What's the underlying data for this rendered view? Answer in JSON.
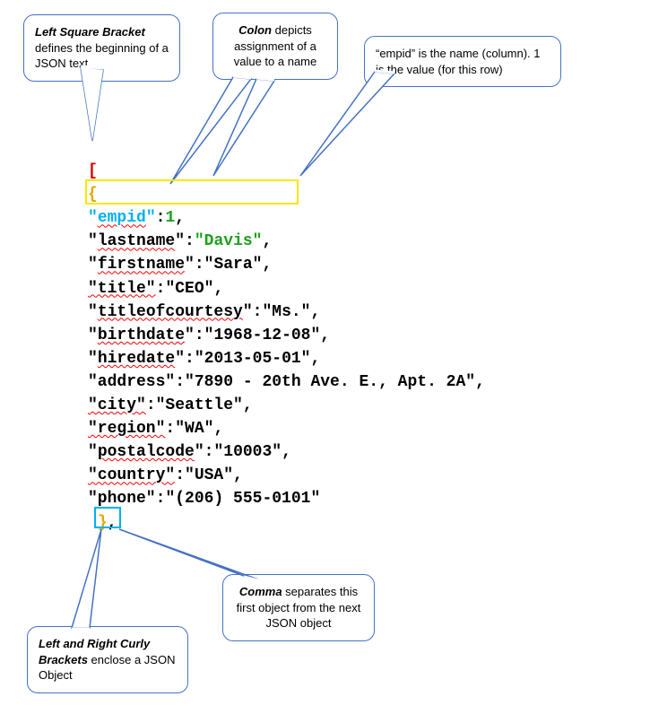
{
  "callouts": {
    "left_bracket": "Left Square Bracket",
    "left_bracket_rest": " defines the beginning of a JSON text",
    "colon": "Colon",
    "colon_rest": " depicts assignment of a value to a name",
    "empid": "“empid” is the name (column). 1 is the value (for this row)",
    "curly": "Left and Right Curly Brackets",
    "curly_rest": " enclose a JSON Object",
    "comma": "Comma",
    "comma_rest": " separates this first object from the next JSON object"
  },
  "json_tokens": {
    "open_bracket": "[",
    "open_brace": "{",
    "k00": "\"",
    "k00b": "empid",
    "k00c": "\"",
    "colon0": ":",
    "v00": "1",
    "comma0": ",",
    "k01": "\"",
    "k01b": "lastname",
    "k01c": "\"",
    "colon1": ":",
    "v01": "\"Davis\"",
    "comma1": ",",
    "k02": "\"",
    "k02b": "firstname",
    "k02c": "\"",
    "colon2": ":",
    "v02": "\"Sara\"",
    "comma2": ",",
    "k03": "\"title\"",
    "colon3": ":",
    "v03": "\"CEO\"",
    "comma3": ",",
    "k04": "\"",
    "k04b": "titleofcourtesy",
    "k04c": "\"",
    "colon4": ":",
    "v04": "\"Ms.\"",
    "comma4": ",",
    "k05": "\"",
    "k05b": "birthdate",
    "k05c": "\"",
    "colon5": ":",
    "v05": "\"1968-12-08\"",
    "comma5": ",",
    "k06": "\"",
    "k06b": "hiredate",
    "k06c": "\"",
    "colon6": ":",
    "v06": "\"2013-05-01\"",
    "comma6": ",",
    "k07": "\"address\"",
    "colon7": ":",
    "v07": "\"7890 - 20th Ave. E., Apt. 2A\"",
    "comma7": ",",
    "k08": "\"city\"",
    "colon8": ":",
    "v08": "\"Seattle\"",
    "comma8": ",",
    "k09": "\"region\"",
    "colon9": ":",
    "v09": "\"WA\"",
    "comma9": ",",
    "k10": "\"",
    "k10b": "postalcode",
    "k10c": "\"",
    "colon10": ":",
    "v10": "\"10003\"",
    "comma10": ",",
    "k11": "\"country\"",
    "colon11": ":",
    "v11": "\"USA\"",
    "comma11": ",",
    "k12": "\"phone\"",
    "colon12": ":",
    "v12": "\"(206) 555-0101\"",
    "close_brace": "}",
    "trailing_comma": ","
  }
}
